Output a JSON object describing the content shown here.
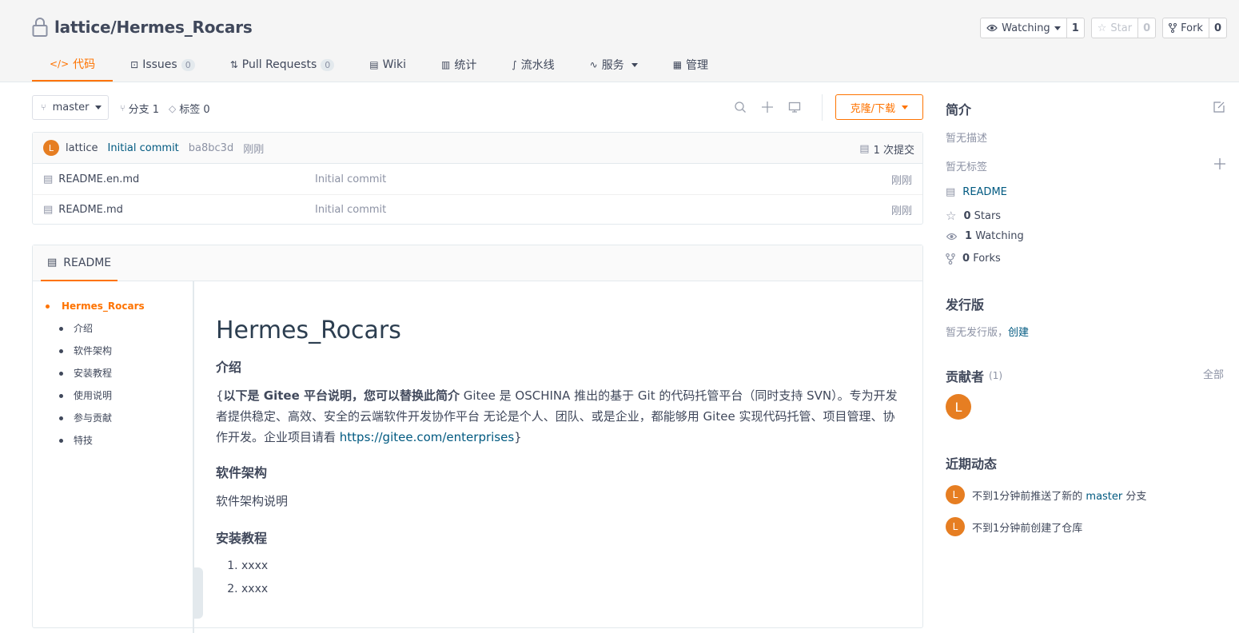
{
  "repo": {
    "name": "lattice/Hermes_Rocars",
    "watch_label": "Watching",
    "watch_count": "1",
    "star_label": "Star",
    "star_count": "0",
    "fork_label": "Fork",
    "fork_count": "0"
  },
  "tabs": [
    {
      "label": "代码",
      "icon": "code-icon",
      "active": true
    },
    {
      "label": "Issues",
      "badge": "0",
      "icon": "issues-icon"
    },
    {
      "label": "Pull Requests",
      "badge": "0",
      "icon": "pull-request-icon"
    },
    {
      "label": "Wiki",
      "icon": "wiki-icon"
    },
    {
      "label": "统计",
      "icon": "chart-icon"
    },
    {
      "label": "流水线",
      "icon": "pipeline-icon"
    },
    {
      "label": "服务",
      "icon": "service-icon",
      "dropdown": true
    },
    {
      "label": "管理",
      "icon": "manage-icon"
    }
  ],
  "branchbar": {
    "branch": "master",
    "branches": "分支 1",
    "tags": "标签 0",
    "clone_label": "克隆/下载"
  },
  "commit": {
    "avatar": "L",
    "author": "lattice",
    "message": "Initial commit",
    "sha": "ba8bc3d",
    "time": "刚刚",
    "total": "1 次提交"
  },
  "files": [
    {
      "name": "README.en.md",
      "message": "Initial commit",
      "time": "刚刚"
    },
    {
      "name": "README.md",
      "message": "Initial commit",
      "time": "刚刚"
    }
  ],
  "readme": {
    "tab_label": "README",
    "toc": [
      {
        "label": "Hermes_Rocars",
        "level": 1
      },
      {
        "label": "介绍",
        "level": 2
      },
      {
        "label": "软件架构",
        "level": 2
      },
      {
        "label": "安装教程",
        "level": 2
      },
      {
        "label": "使用说明",
        "level": 2
      },
      {
        "label": "参与贡献",
        "level": 2
      },
      {
        "label": "特技",
        "level": 2
      }
    ],
    "h1": "Hermes_Rocars",
    "intro_heading": "介绍",
    "intro_prefix": "{",
    "intro_bold": "以下是 Gitee 平台说明，您可以替换此简介",
    "intro_text": " Gitee 是 OSCHINA 推出的基于 Git 的代码托管平台（同时支持 SVN）。专为开发者提供稳定、高效、安全的云端软件开发协作平台 无论是个人、团队、或是企业，都能够用 Gitee 实现代码托管、项目管理、协作开发。企业项目请看 ",
    "intro_link": "https://gitee.com/enterprises",
    "intro_suffix": "}",
    "arch_heading": "软件架构",
    "arch_text": "软件架构说明",
    "install_heading": "安装教程",
    "install_steps": [
      "xxxx",
      "xxxx"
    ]
  },
  "sidebar": {
    "intro_title": "简介",
    "no_desc": "暂无描述",
    "no_tags": "暂无标签",
    "readme_link": "README",
    "stars_count": "0",
    "stars_label": "Stars",
    "watching_count": "1",
    "watching_label": "Watching",
    "forks_count": "0",
    "forks_label": "Forks",
    "release_title": "发行版",
    "no_release": "暂无发行版，",
    "create_link": "创建",
    "contrib_title": "贡献者",
    "contrib_count": "(1)",
    "contrib_all": "全部",
    "contrib_avatar": "L",
    "activity_title": "近期动态",
    "activity": [
      {
        "avatar": "L",
        "prefix": "不到1分钟前推送了新的 ",
        "link": "master",
        "suffix": " 分支"
      },
      {
        "avatar": "L",
        "prefix": "不到1分钟前创建了仓库",
        "link": "",
        "suffix": ""
      }
    ]
  },
  "colors": {
    "accent": "#fe7300",
    "link": "#005980",
    "avatar": "#e67e22"
  }
}
